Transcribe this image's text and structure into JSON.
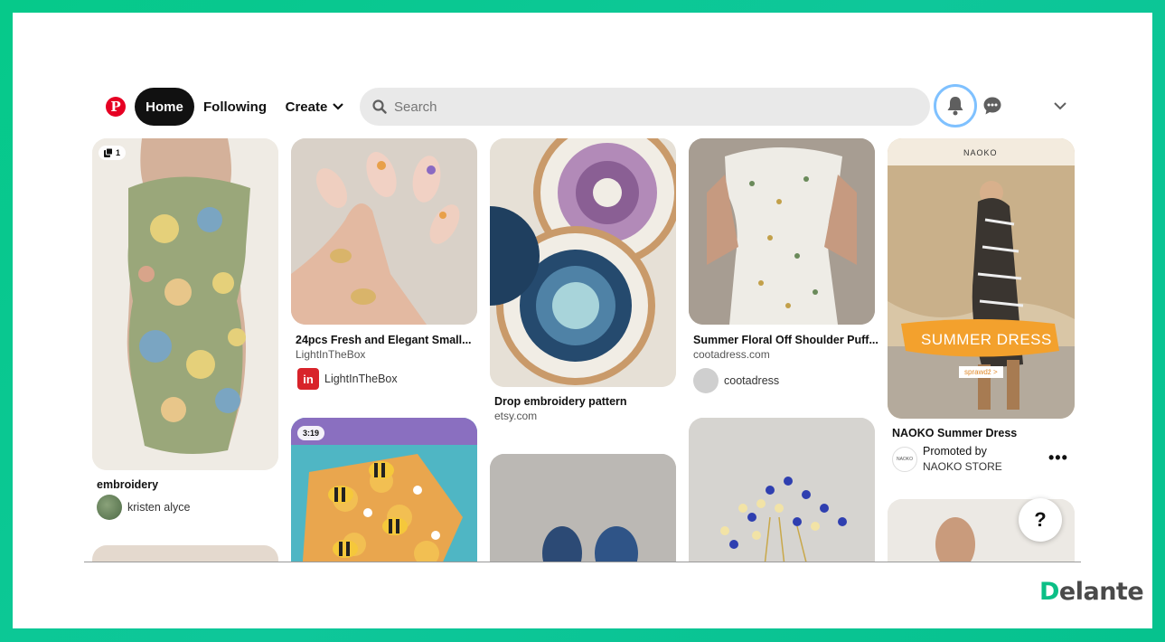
{
  "brand": {
    "frame_color": "#06c98a",
    "pinterest_red": "#e60023",
    "watermark_prefix": "D",
    "watermark_rest": "elante"
  },
  "nav": {
    "logo_icon": "pinterest-logo-icon",
    "home_label": "Home",
    "following_label": "Following",
    "create_label": "Create",
    "search_placeholder": "Search"
  },
  "icons": {
    "notifications": "bell-icon",
    "messages": "chat-bubble-icon",
    "account": "chevron-down-icon"
  },
  "pins": [
    {
      "title": "embroidery",
      "user": "kristen alyce",
      "badge": "1"
    },
    {
      "title": "24pcs Fresh and Elegant Small...",
      "source": "LightInTheBox",
      "user": "LightInTheBox"
    },
    {
      "badge": "3:19"
    },
    {
      "title": "Drop embroidery pattern",
      "source": "etsy.com"
    },
    {
      "title": "Summer Floral Off Shoulder Puff...",
      "source": "cootadress.com",
      "user": "cootadress"
    },
    {
      "title": "NAOKO Summer Dress",
      "promoted_label": "Promoted by",
      "user": "NAOKO STORE",
      "ad_brand": "NAOKO",
      "ad_headline": "SUMMER DRESS",
      "ad_cta": "sprawdź >"
    }
  ],
  "help_label": "?"
}
